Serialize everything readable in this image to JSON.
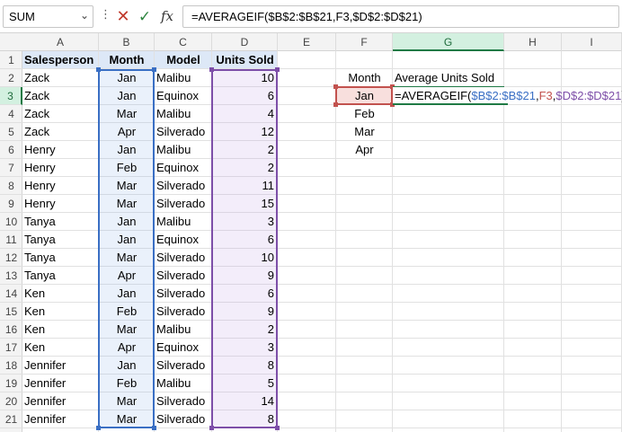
{
  "formula_bar": {
    "name_box": "SUM",
    "cancel_icon": "✕",
    "enter_icon": "✓",
    "fx_label": "fx",
    "formula": "=AVERAGEIF($B$2:$B$21,F3,$D$2:$D$21)"
  },
  "columns": [
    "A",
    "B",
    "C",
    "D",
    "E",
    "F",
    "G",
    "H",
    "I"
  ],
  "rows": [
    "1",
    "2",
    "3",
    "4",
    "5",
    "6",
    "7",
    "8",
    "9",
    "10",
    "11",
    "12",
    "13",
    "14",
    "15",
    "16",
    "17",
    "18",
    "19",
    "20",
    "21"
  ],
  "headers": {
    "salesperson": "Salesperson",
    "month": "Month",
    "model": "Model",
    "units": "Units Sold"
  },
  "table": [
    [
      "Zack",
      "Jan",
      "Malibu",
      "10"
    ],
    [
      "Zack",
      "Jan",
      "Equinox",
      "6"
    ],
    [
      "Zack",
      "Mar",
      "Malibu",
      "4"
    ],
    [
      "Zack",
      "Apr",
      "Silverado",
      "12"
    ],
    [
      "Henry",
      "Jan",
      "Malibu",
      "2"
    ],
    [
      "Henry",
      "Feb",
      "Equinox",
      "2"
    ],
    [
      "Henry",
      "Mar",
      "Silverado",
      "11"
    ],
    [
      "Henry",
      "Mar",
      "Silverado",
      "15"
    ],
    [
      "Tanya",
      "Jan",
      "Malibu",
      "3"
    ],
    [
      "Tanya",
      "Jan",
      "Equinox",
      "6"
    ],
    [
      "Tanya",
      "Mar",
      "Silverado",
      "10"
    ],
    [
      "Tanya",
      "Apr",
      "Silverado",
      "9"
    ],
    [
      "Ken",
      "Jan",
      "Silverado",
      "6"
    ],
    [
      "Ken",
      "Feb",
      "Silverado",
      "9"
    ],
    [
      "Ken",
      "Mar",
      "Malibu",
      "2"
    ],
    [
      "Ken",
      "Apr",
      "Equinox",
      "3"
    ],
    [
      "Jennifer",
      "Jan",
      "Silverado",
      "8"
    ],
    [
      "Jennifer",
      "Feb",
      "Malibu",
      "5"
    ],
    [
      "Jennifer",
      "Mar",
      "Silverado",
      "14"
    ],
    [
      "Jennifer",
      "Mar",
      "Silverado",
      "8"
    ]
  ],
  "lookup": {
    "month_header": "Month",
    "avg_header": "Average Units Sold",
    "months": [
      "Jan",
      "Feb",
      "Mar",
      "Apr"
    ],
    "formula_parts": [
      "=AVERAGEIF(",
      "$B$2:$B$21",
      ",",
      "F3",
      ",",
      "$D$2:$D$21",
      ")"
    ]
  },
  "colors": {
    "range_b": "#3a6fc4",
    "range_d": "#7d4ea8",
    "range_f": "#c2524e",
    "active": "#1f7a45"
  }
}
